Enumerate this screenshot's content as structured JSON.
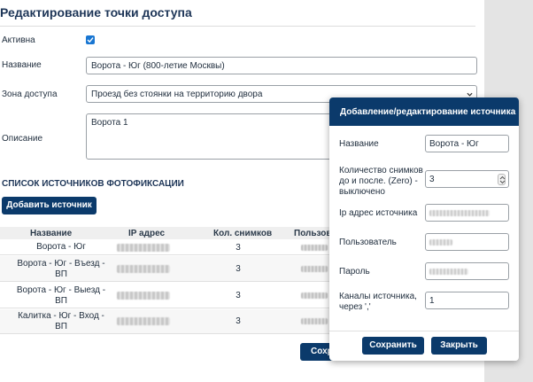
{
  "page": {
    "title": "Редактирование точки доступа",
    "active_label": "Активна",
    "active_checked": true,
    "name_label": "Название",
    "name_value": "Ворота - Юг (800-летие Москвы)",
    "zone_label": "Зона доступа",
    "zone_value": "Проезд без стоянки на территорию двора",
    "description_label": "Описание",
    "description_value": "Ворота 1",
    "sources_section_title": "СПИСОК ИСТОЧНИКОВ ФОТОФИКСАЦИИ",
    "add_source_label": "Добавить источник",
    "save_label": "Сохр"
  },
  "table": {
    "headers": [
      "Название",
      "IP адрес",
      "Кол. снимков",
      "Пользоват"
    ],
    "rows": [
      {
        "name": "Ворота - Юг",
        "count": "3"
      },
      {
        "name": "Ворота - Юг - Въезд - ВП",
        "count": "3"
      },
      {
        "name": "Ворота - Юг - Выезд - ВП",
        "count": "3"
      },
      {
        "name": "Калитка - Юг - Вход - ВП",
        "count": "3"
      }
    ]
  },
  "modal": {
    "title": "Добавление/редактирование источника",
    "name_label": "Название",
    "name_value": "Ворота - Юг",
    "snapshots_label": "Количество снимков до и после. (Zero) - выключено",
    "snapshots_value": "3",
    "ip_label": "Ip адрес источника",
    "user_label": "Пользователь",
    "password_label": "Пароль",
    "channels_label": "Каналы источника, через ','",
    "channels_value": "1",
    "save_label": "Сохранить",
    "close_label": "Закрыть"
  },
  "colors": {
    "primary": "#0b3a6b",
    "checkbox": "#1976d2"
  }
}
